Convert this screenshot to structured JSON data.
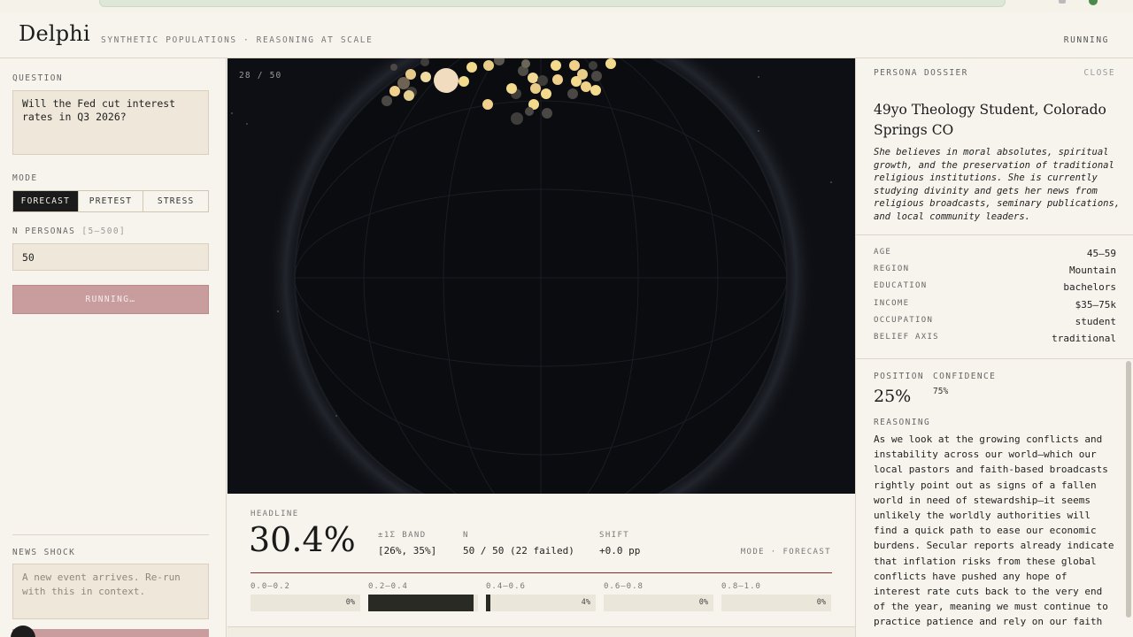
{
  "header": {
    "brand": "Delphi",
    "tagline": "SYNTHETIC POPULATIONS · REASONING AT SCALE",
    "status": "RUNNING"
  },
  "left": {
    "question_label": "QUESTION",
    "question_value": "Will the Fed cut interest rates in Q3 2026?",
    "mode_label": "MODE",
    "modes": [
      "FORECAST",
      "PRETEST",
      "STRESS"
    ],
    "active_mode": "FORECAST",
    "npersonas_label": "N PERSONAS",
    "npersonas_hint": "[5–500]",
    "npersonas_value": "50",
    "run_label": "RUNNING…",
    "news_label": "NEWS SHOCK",
    "news_placeholder": "A new event arrives. Re-run with this in context."
  },
  "viz": {
    "progress": "28 / 50"
  },
  "stats": {
    "headline_label": "HEADLINE",
    "headline_value": "30.4%",
    "band_label": "±1Σ BAND",
    "band_value": "[26%, 35%]",
    "n_label": "N",
    "n_value": "50 / 50 (22 failed)",
    "shift_label": "SHIFT",
    "shift_value": "+0.0 pp",
    "mode_tag": "MODE · FORECAST",
    "bins": [
      {
        "label": "0.0–0.2",
        "pct": "0%",
        "fraction": 0
      },
      {
        "label": "0.2–0.4",
        "pct": "",
        "fraction": 0.96
      },
      {
        "label": "0.4–0.6",
        "pct": "4%",
        "fraction": 0.04
      },
      {
        "label": "0.6–0.8",
        "pct": "0%",
        "fraction": 0
      },
      {
        "label": "0.8–1.0",
        "pct": "0%",
        "fraction": 0
      }
    ]
  },
  "dossier": {
    "label": "PERSONA DOSSIER",
    "close": "CLOSE",
    "title": "49yo Theology Student, Colorado Springs CO",
    "description": "She believes in moral absolutes, spiritual growth, and the preservation of traditional religious institutions. She is currently studying divinity and gets her news from religious broadcasts, seminary publications, and local community leaders.",
    "attributes": [
      {
        "key": "AGE",
        "value": "45–59"
      },
      {
        "key": "REGION",
        "value": "Mountain"
      },
      {
        "key": "EDUCATION",
        "value": "bachelors"
      },
      {
        "key": "INCOME",
        "value": "$35–75k"
      },
      {
        "key": "OCCUPATION",
        "value": "student"
      },
      {
        "key": "BELIEF AXIS",
        "value": "traditional"
      }
    ],
    "position_label": "POSITION",
    "position_value": "25%",
    "confidence_label": "CONFIDENCE",
    "confidence_value": "75%",
    "reasoning_label": "REASONING",
    "reasoning": "As we look at the growing conflicts and instability across our world—which our local pastors and faith-based broadcasts rightly point out as signs of a fallen world in need of stewardship—it seems unlikely the worldly authorities will find a quick path to ease our economic burdens. Secular reports already indicate that inflation risks from these global conflicts have pushed any hope of interest rate cuts back to the very end of the year, meaning we must continue to practice patience and rely on our faith"
  }
}
